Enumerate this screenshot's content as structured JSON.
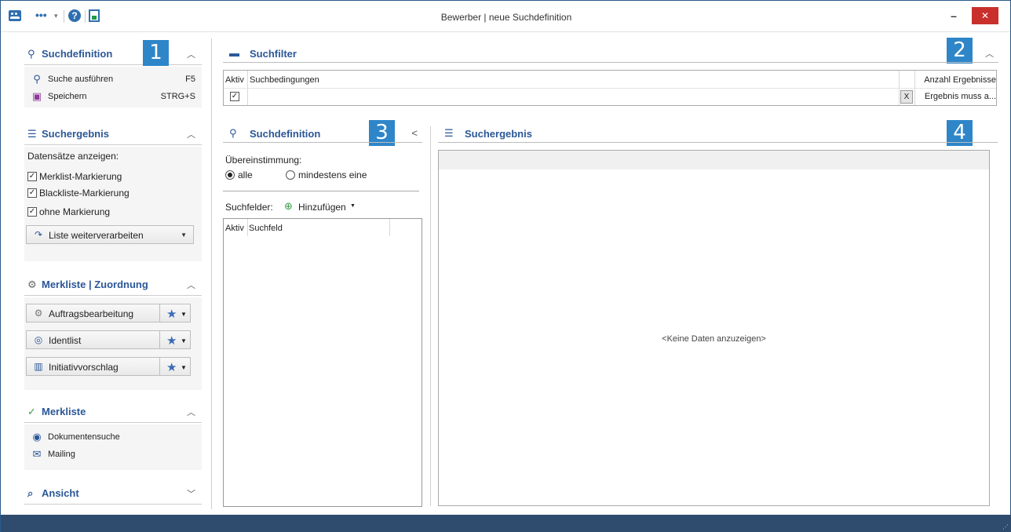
{
  "window": {
    "title": "Bewerber | neue Suchdefinition",
    "minimize": "–",
    "close": "✕",
    "quick_dots": "•••",
    "help": "?"
  },
  "sidebar": {
    "suchdefinition": {
      "title": "Suchdefinition",
      "commands": [
        {
          "label": "Suche ausführen",
          "shortcut": "F5"
        },
        {
          "label": "Speichern",
          "shortcut": "STRG+S"
        }
      ]
    },
    "suchergebnis": {
      "title": "Suchergebnis",
      "subtitle": "Datensätze anzeigen:",
      "checkboxes": [
        {
          "label": "Merklist-Markierung",
          "checked": true
        },
        {
          "label": "Blackliste-Markierung",
          "checked": true
        },
        {
          "label": "ohne Markierung",
          "checked": true
        }
      ],
      "action_button": "Liste weiterverarbeiten"
    },
    "merkliste_zuordnung": {
      "title": "Merkliste | Zuordnung",
      "buttons": [
        "Auftragsbearbeitung",
        "Identlist",
        "Initiativvorschlag"
      ]
    },
    "merkliste": {
      "title": "Merkliste",
      "commands": [
        "Dokumentensuche",
        "Mailing"
      ]
    },
    "ansicht": {
      "title": "Ansicht"
    }
  },
  "callouts": [
    "1",
    "2",
    "3",
    "4"
  ],
  "suchfilter": {
    "title": "Suchfilter",
    "columns": {
      "aktiv": "Aktiv",
      "bedingungen": "Suchbedingungen",
      "anzahl": "Anzahl Ergebnisse"
    },
    "row": {
      "aktiv_checked": true,
      "clear": "X",
      "ergebnis": "Ergebnis muss a..."
    }
  },
  "suchdefinition_panel": {
    "title": "Suchdefinition",
    "collapse": "<",
    "uebereinstimmung_label": "Übereinstimmung:",
    "options": [
      {
        "label": "alle",
        "selected": true
      },
      {
        "label": "mindestens eine",
        "selected": false
      }
    ],
    "suchfelder_label": "Suchfelder:",
    "add_button": "Hinzufügen",
    "columns": {
      "aktiv": "Aktiv",
      "suchfeld": "Suchfeld"
    }
  },
  "suchergebnis_panel": {
    "title": "Suchergebnis",
    "empty": "<Keine Daten anzuzeigen>"
  },
  "colors": {
    "accent": "#2b5797",
    "callout": "#2e86c9",
    "statusbar": "#2f4b6e",
    "close": "#c9302c"
  }
}
